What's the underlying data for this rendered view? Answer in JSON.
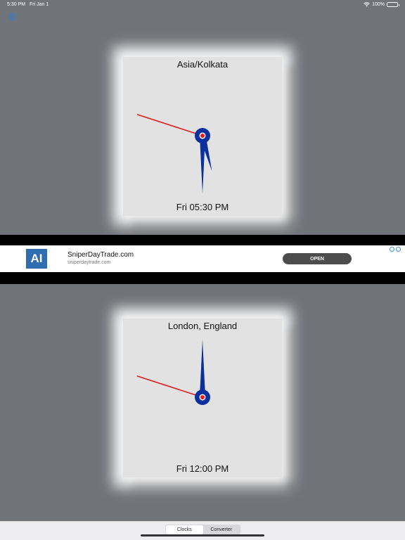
{
  "status_bar": {
    "time": "5:30 PM",
    "date": "Fri Jan 1",
    "battery": "100%"
  },
  "clocks": [
    {
      "zone": "Asia/Kolkata",
      "time": "Fri 05:30 PM",
      "hour": 5,
      "minute": 30,
      "second": 48
    },
    {
      "zone": "London, England",
      "time": "Fri 12:00 PM",
      "hour": 12,
      "minute": 0,
      "second": 48
    }
  ],
  "ad": {
    "logo_text": "AI",
    "title": "SniperDayTrade.com",
    "url": "sniperdaytrade.com",
    "button": "OPEN"
  },
  "tabs": [
    {
      "label": "Clocks",
      "active": true
    },
    {
      "label": "Converter",
      "active": false
    }
  ],
  "colors": {
    "background": "#707378",
    "panel": "#e2e2e2",
    "hand": "#0a2f9e",
    "second_hand": "#e41e1e"
  },
  "icons": [
    "settings-icon",
    "wifi-icon",
    "battery-icon",
    "ad-choices-icon"
  ]
}
